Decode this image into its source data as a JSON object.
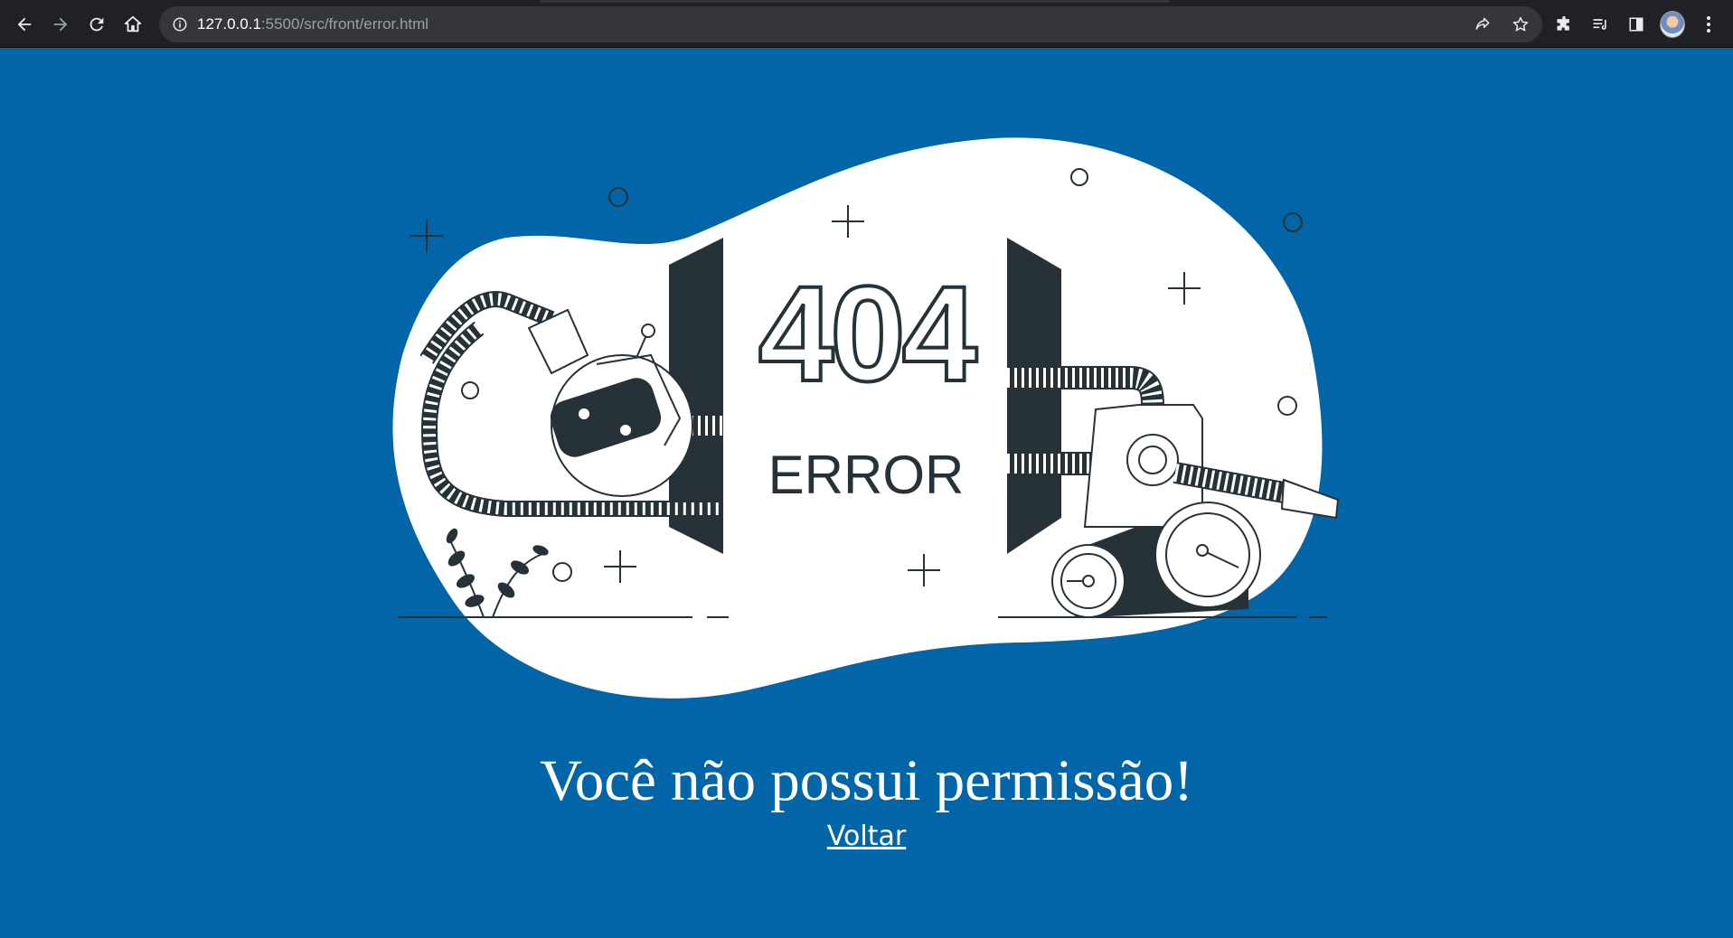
{
  "browser": {
    "url_host": "127.0.0.1",
    "url_path": ":5500/src/front/error.html",
    "icons": [
      "back-icon",
      "forward-icon",
      "reload-icon",
      "home-icon",
      "info-icon",
      "share-icon",
      "star-icon",
      "extensions-icon",
      "reading-list-icon",
      "side-panel-icon",
      "profile-avatar",
      "menu-icon"
    ]
  },
  "illustration": {
    "code": "404",
    "label": "ERROR"
  },
  "page": {
    "message": "Você não possui permissão!",
    "back_link": "Voltar"
  },
  "colors": {
    "background": "#0265a7",
    "blob": "#ffffff",
    "ink": "#263238",
    "browser_chrome": "#202124"
  }
}
